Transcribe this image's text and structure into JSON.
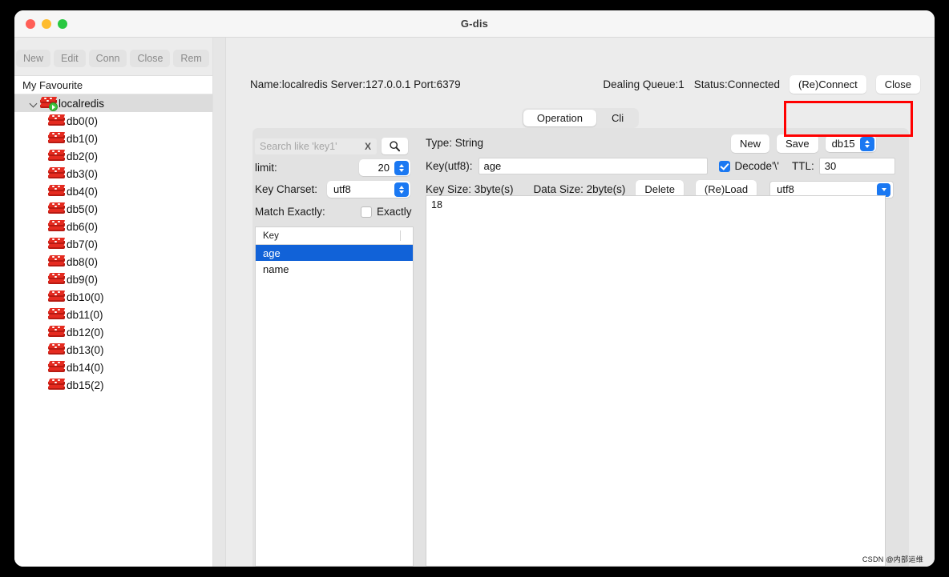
{
  "window": {
    "title": "G-dis"
  },
  "left_toolbar": {
    "buttons": [
      {
        "label": "New",
        "name": "new-connection-button"
      },
      {
        "label": "Edit",
        "name": "edit-connection-button"
      },
      {
        "label": "Conn",
        "name": "connect-button"
      },
      {
        "label": "Close",
        "name": "close-connection-button"
      },
      {
        "label": "Rem",
        "name": "remove-connection-button"
      }
    ]
  },
  "sidebar": {
    "header": "My Favourite",
    "root": {
      "label": "localredis",
      "expanded": true
    },
    "databases": [
      {
        "label": "db0(0)"
      },
      {
        "label": "db1(0)"
      },
      {
        "label": "db2(0)"
      },
      {
        "label": "db3(0)"
      },
      {
        "label": "db4(0)"
      },
      {
        "label": "db5(0)"
      },
      {
        "label": "db6(0)"
      },
      {
        "label": "db7(0)"
      },
      {
        "label": "db8(0)"
      },
      {
        "label": "db9(0)"
      },
      {
        "label": "db10(0)"
      },
      {
        "label": "db11(0)"
      },
      {
        "label": "db12(0)"
      },
      {
        "label": "db13(0)"
      },
      {
        "label": "db14(0)"
      },
      {
        "label": "db15(2)"
      }
    ]
  },
  "connection_bar": {
    "info": "Name:localredis Server:127.0.0.1 Port:6379",
    "dealing_queue": "Dealing Queue:1",
    "status": "Status:Connected",
    "reconnect_label": "(Re)Connect",
    "close_label": "Close"
  },
  "tabs": [
    {
      "label": "Operation",
      "active": true
    },
    {
      "label": "Cli",
      "active": false
    }
  ],
  "search_panel": {
    "search_placeholder": "Search like 'key1'",
    "search_value": "",
    "clear_label": "X",
    "search_icon": "magnifier-icon",
    "limit_label": "limit:",
    "limit_value": "20",
    "key_charset_label": "Key Charset:",
    "key_charset_value": "utf8",
    "match_exactly_label": "Match Exactly:",
    "exactly_label": "Exactly",
    "exactly_checked": false
  },
  "key_list": {
    "column_header": "Key",
    "rows": [
      {
        "label": "age",
        "selected": true
      },
      {
        "label": "name",
        "selected": false
      }
    ]
  },
  "value_panel": {
    "type_label": "Type: String",
    "new_label": "New",
    "save_label": "Save",
    "db_selector_value": "db15",
    "key_label": "Key(utf8):",
    "key_value": "age",
    "decode_label": "Decode'\\'",
    "decode_checked": true,
    "ttl_label": "TTL:",
    "ttl_value": "30",
    "key_size_label": "Key Size: 3byte(s)",
    "data_size_label": "Data Size: 2byte(s)",
    "delete_label": "Delete",
    "reload_label": "(Re)Load",
    "charset_value": "utf8",
    "value_text": "18"
  },
  "annotation": {
    "color": "#ff0000"
  },
  "watermark": {
    "text": "CSDN @内部运维"
  }
}
